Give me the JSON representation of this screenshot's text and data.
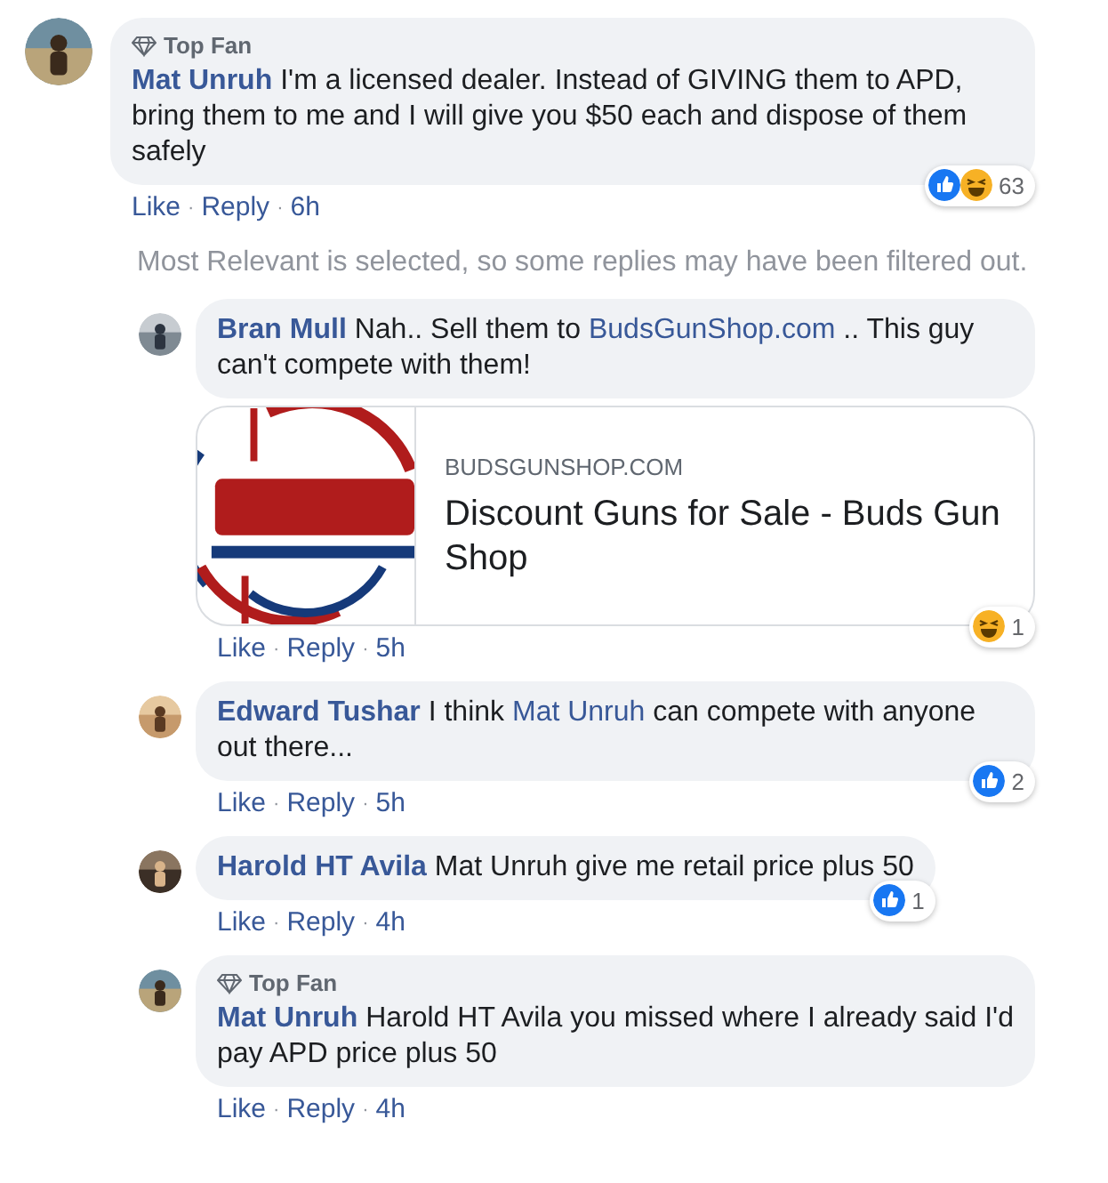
{
  "comment": {
    "badge": "Top Fan",
    "author": "Mat Unruh",
    "body": [
      {
        "kind": "text",
        "text": "I'm a licensed dealer. Instead of GIVING them to APD, bring them to me and I will give you $50 each and dispose of them safely"
      }
    ],
    "reactions": {
      "icons": [
        {
          "kind": "like"
        },
        {
          "kind": "haha"
        }
      ],
      "count": "63"
    },
    "actions": [
      {
        "kind": "like",
        "text": "Like"
      },
      {
        "kind": "dot",
        "text": "·"
      },
      {
        "kind": "reply",
        "text": "Reply"
      },
      {
        "kind": "dot",
        "text": "·"
      },
      {
        "kind": "time",
        "text": "6h"
      }
    ],
    "filter_notice": "Most Relevant is selected, so some replies may have been filtered out.",
    "replies": [
      {
        "author": "Bran Mull",
        "body": [
          {
            "kind": "text",
            "text": "Nah.. Sell them to "
          },
          {
            "kind": "link",
            "text": "BudsGunShop.com"
          },
          {
            "kind": "text",
            "text": " .. This guy can't compete with them!"
          }
        ],
        "preview": {
          "kind": "picture",
          "domain": "BUDSGUNSHOP.COM",
          "title": "Discount Guns for Sale - Buds Gun Shop"
        },
        "reactions": {
          "icons": [
            {
              "kind": "haha"
            }
          ],
          "count": "1"
        },
        "actions": [
          {
            "kind": "like",
            "text": "Like"
          },
          {
            "kind": "dot",
            "text": "·"
          },
          {
            "kind": "reply",
            "text": "Reply"
          },
          {
            "kind": "dot",
            "text": "·"
          },
          {
            "kind": "time",
            "text": "5h"
          }
        ]
      },
      {
        "author": "Edward Tushar",
        "body": [
          {
            "kind": "text",
            "text": "I think "
          },
          {
            "kind": "link",
            "text": "Mat Unruh"
          },
          {
            "kind": "text",
            "text": " can compete with anyone out there..."
          }
        ],
        "reactions": {
          "icons": [
            {
              "kind": "like"
            }
          ],
          "count": "2"
        },
        "actions": [
          {
            "kind": "like",
            "text": "Like"
          },
          {
            "kind": "dot",
            "text": "·"
          },
          {
            "kind": "reply",
            "text": "Reply"
          },
          {
            "kind": "dot",
            "text": "·"
          },
          {
            "kind": "time",
            "text": "5h"
          }
        ]
      },
      {
        "author": "Harold HT Avila",
        "body": [
          {
            "kind": "text",
            "text": "Mat Unruh give me retail price plus 50"
          }
        ],
        "reactions": {
          "icons": [
            {
              "kind": "like"
            }
          ],
          "count": "1"
        },
        "actions": [
          {
            "kind": "like",
            "text": "Like"
          },
          {
            "kind": "dot",
            "text": "·"
          },
          {
            "kind": "reply",
            "text": "Reply"
          },
          {
            "kind": "dot",
            "text": "·"
          },
          {
            "kind": "time",
            "text": "4h"
          }
        ]
      },
      {
        "badge": "Top Fan",
        "author": "Mat Unruh",
        "body": [
          {
            "kind": "text",
            "text": "Harold HT Avila you missed where I already said I'd pay APD price plus 50"
          }
        ],
        "actions": [
          {
            "kind": "like",
            "text": "Like"
          },
          {
            "kind": "dot",
            "text": "·"
          },
          {
            "kind": "reply",
            "text": "Reply"
          },
          {
            "kind": "dot",
            "text": "·"
          },
          {
            "kind": "time",
            "text": "4h"
          }
        ]
      }
    ]
  }
}
